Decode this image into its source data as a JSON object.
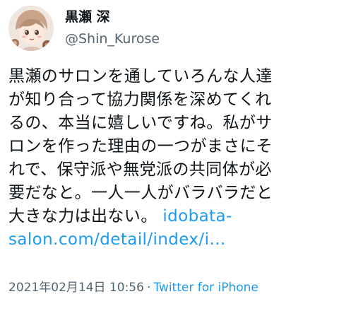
{
  "user": {
    "display_name": "黒瀬 深",
    "handle": "@Shin_Kurose",
    "avatar_icon": "user-avatar-icon"
  },
  "tweet": {
    "body_lines": [
      "黒瀬のサロンを通していろんな人達",
      "が知り合って協力関係を深めてくれ",
      "るの、本当に嬉しいですね。私がサ",
      "ロンを作った理由の一つがまさにそ",
      "れで、保守派や無党派の共同体が必",
      "要だなと。一人一人がバラバラだと",
      "大きな力は出ない。"
    ],
    "link_part1": "idobata-",
    "link_part2": "salon.com/detail/index/i…",
    "link_color": "#1d9bf0"
  },
  "meta": {
    "timestamp": "2021年02月14日 10:56",
    "separator": "·",
    "source": "Twitter for iPhone"
  }
}
